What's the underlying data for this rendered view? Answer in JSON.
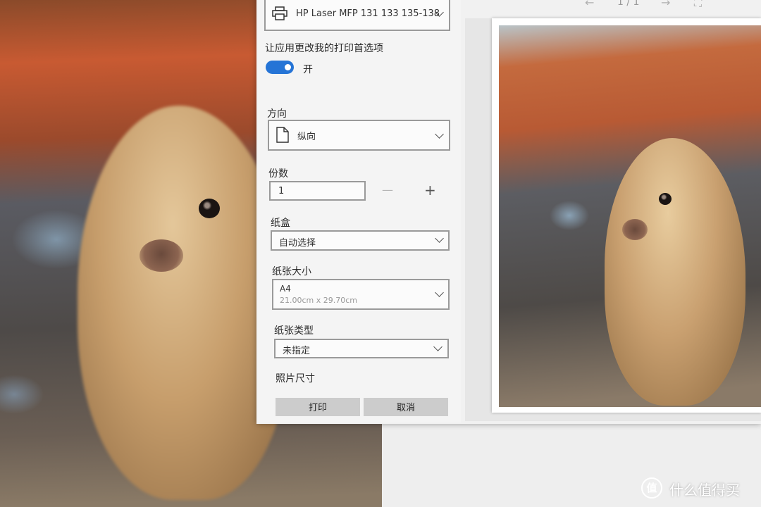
{
  "printer": {
    "name": "HP Laser MFP 131 133 135-138",
    "icon": "printer-icon"
  },
  "preferences": {
    "label": "让应用更改我的打印首选项",
    "toggle_state": "开",
    "toggle_on": true
  },
  "orientation": {
    "label": "方向",
    "value": "纵向",
    "icon": "portrait-page-icon"
  },
  "copies": {
    "label": "份数",
    "value": "1",
    "decrement": "—",
    "increment": "+"
  },
  "tray": {
    "label": "纸盒",
    "value": "自动选择"
  },
  "paper_size": {
    "label": "纸张大小",
    "value": "A4",
    "dimensions": "21.00cm x 29.70cm"
  },
  "paper_type": {
    "label": "纸张类型",
    "value": "未指定"
  },
  "photo_size": {
    "label": "照片尺寸"
  },
  "buttons": {
    "print": "打印",
    "cancel": "取消"
  },
  "preview": {
    "page_counter": "1 / 1"
  },
  "watermark": {
    "text": "什么值得买",
    "badge": "值"
  },
  "colors": {
    "accent": "#2574d6",
    "button": "#cccccc"
  }
}
